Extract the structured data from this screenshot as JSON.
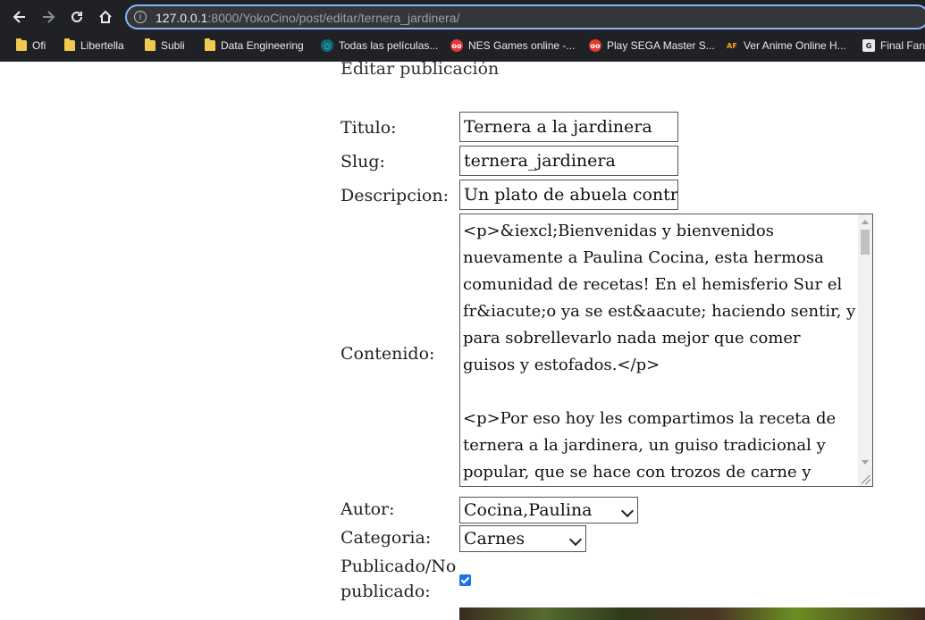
{
  "browser": {
    "url_host": "127.0.0.1",
    "url_path": ":8000/YokoCino/post/editar/ternera_jardinera/",
    "bookmarks": [
      {
        "label": "Ofi",
        "icon": "folder-icon"
      },
      {
        "label": "Libertella",
        "icon": "folder-icon"
      },
      {
        "label": "Subli",
        "icon": "folder-icon"
      },
      {
        "label": "Data Engineering",
        "icon": "folder-icon"
      },
      {
        "label": "Todas las películas...",
        "icon": "site-favicon"
      },
      {
        "label": "NES Games online -...",
        "icon": "gamepad-favicon"
      },
      {
        "label": "Play SEGA Master S...",
        "icon": "gamepad-favicon"
      },
      {
        "label": "Ver Anime Online H...",
        "icon": "af-favicon"
      },
      {
        "label": "Final Fan",
        "icon": "g-favicon"
      }
    ]
  },
  "form": {
    "heading": "Editar publicación",
    "titulo_label": "Titulo:",
    "titulo_value": "Ternera a la jardinera",
    "slug_label": "Slug:",
    "slug_value": "ternera_jardinera",
    "descripcion_label": "Descripcion:",
    "descripcion_value": "Un plato de abuela contra",
    "contenido_label": "Contenido:",
    "contenido_value": "<p>&iexcl;Bienvenidas y bienvenidos nuevamente a Paulina Cocina, esta hermosa comunidad de recetas! En el hemisferio Sur el fr&iacute;o ya se est&aacute; haciendo sentir, y para sobrellevarlo nada mejor que comer guisos y estofados.</p>\n\n<p>Por eso hoy les compartimos la receta de ternera a la jardinera, un guiso tradicional y popular, que se hace con trozos de carne y",
    "autor_label": "Autor:",
    "autor_value": "Cocina,Paulina",
    "categoria_label": "Categoria:",
    "categoria_value": "Carnes",
    "publicado_label": "Publicado/No publicado:",
    "publicado_checked": true
  },
  "colors": {
    "chrome_bg": "#202124",
    "url_focus": "#8ab4f8",
    "checkbox": "#1a73e8"
  }
}
